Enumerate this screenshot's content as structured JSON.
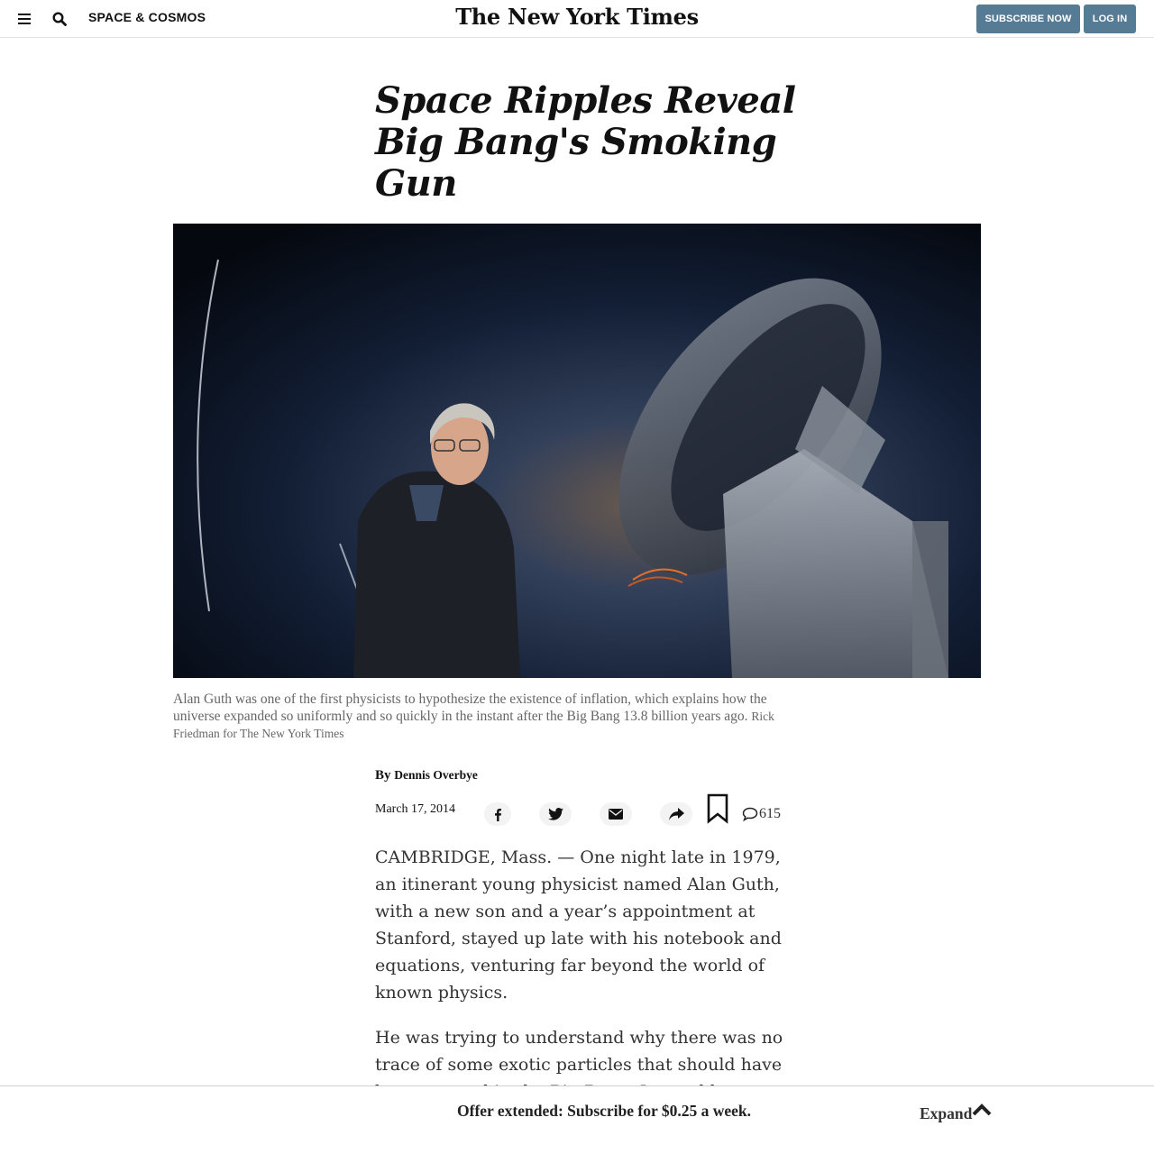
{
  "header": {
    "section_label": "SPACE & COSMOS",
    "logo_text": "The New York Times",
    "subscribe_label": "SUBSCRIBE NOW",
    "login_label": "LOG IN",
    "icons": [
      "menu-icon",
      "search-icon"
    ]
  },
  "article": {
    "headline": "Space Ripples Reveal Big Bang's Smoking Gun",
    "caption": "Alan Guth was one of the first physicists to hypothesize the existence of inflation, which explains how the universe expanded so uniformly and so quickly in the instant after the Big Bang 13.8 billion years ago.",
    "photo_credit": "Rick Friedman for The New York Times",
    "byline_prefix": "By",
    "author": "Dennis Overbye",
    "date": "March 17, 2014",
    "comment_count": "615",
    "share_icons": [
      "facebook-icon",
      "twitter-icon",
      "email-icon",
      "share-icon",
      "bookmark-icon",
      "comment-icon"
    ],
    "paragraphs": [
      "CAMBRIDGE, Mass. — One night late in 1979, an itinerant young physicist named Alan Guth, with a new son and a year’s appointment at Stanford, stayed up late with his notebook and equations, venturing far beyond the world of known physics.",
      "He was trying to understand why there was no trace of some exotic particles that should have been created in the Big Bang. Instead he"
    ]
  },
  "offer": {
    "text": "Offer extended: Subscribe for $0.25 a week.",
    "expand_label": "Expand",
    "expand_icon": "chevron-up-icon"
  },
  "colors": {
    "button_bg": "#567b95",
    "caption_text": "#666666",
    "body_text": "#333333"
  }
}
